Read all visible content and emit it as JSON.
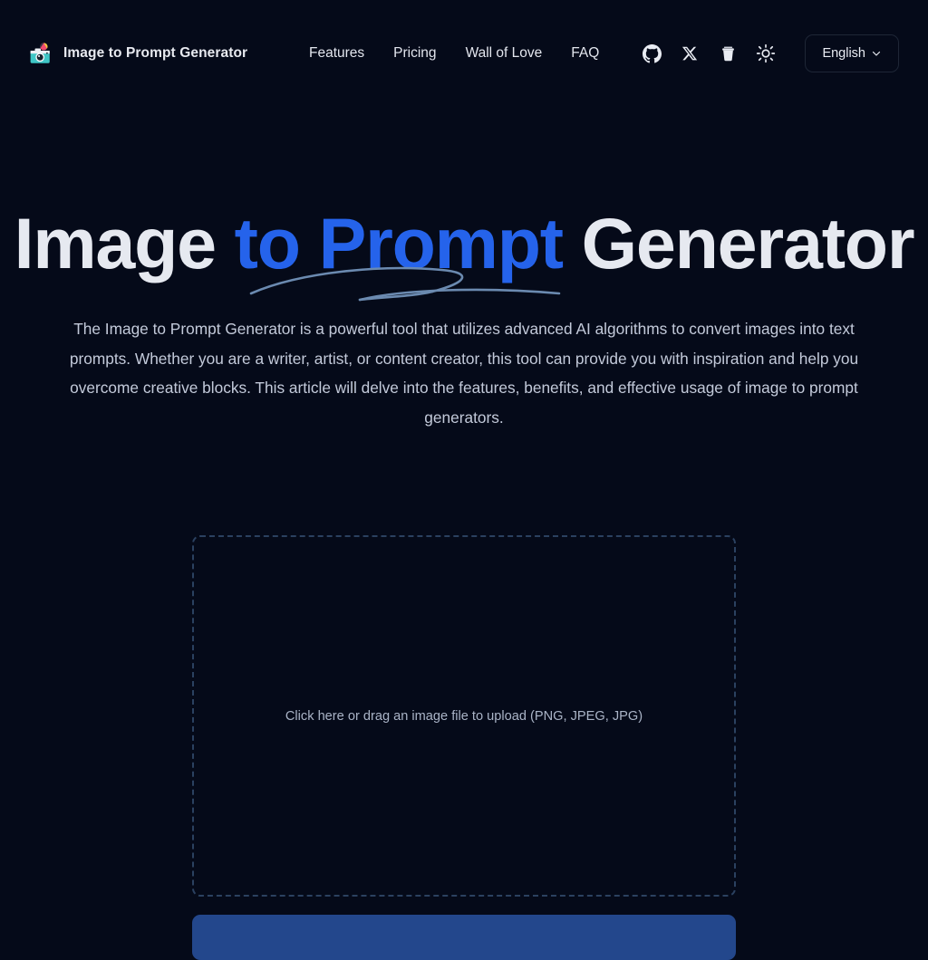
{
  "brand": {
    "logo_icon": "camera-icon",
    "title": "Image to Prompt Generator"
  },
  "nav": {
    "items": [
      {
        "label": "Features"
      },
      {
        "label": "Pricing"
      },
      {
        "label": "Wall of Love"
      },
      {
        "label": "FAQ"
      }
    ]
  },
  "header_actions": {
    "github": "github-icon",
    "x": "x-twitter-icon",
    "coffee": "coffee-cup-icon",
    "theme": "sun-icon",
    "language_label": "English",
    "language_chevron": "chevron-down-icon"
  },
  "hero": {
    "title_part1": "Image ",
    "title_accent": "to Prompt",
    "title_part2": " Generator",
    "description": "The Image to Prompt Generator is a powerful tool that utilizes advanced AI algorithms to convert images into text prompts. Whether you are a writer, artist, or content creator, this tool can provide you with inspiration and help you overcome creative blocks. This article will delve into the features, benefits, and effective usage of image to prompt generators."
  },
  "upload": {
    "dropzone_text": "Click here or drag an image file to upload (PNG, JPEG, JPG)",
    "submit_label": ""
  },
  "colors": {
    "background": "#050a19",
    "accent_blue": "#2563eb",
    "button_blue": "#23478c",
    "dashed_border": "#2b4160",
    "swoosh": "#6b8ab0",
    "text_primary": "#e6e9f0",
    "text_muted": "#c3cada"
  }
}
